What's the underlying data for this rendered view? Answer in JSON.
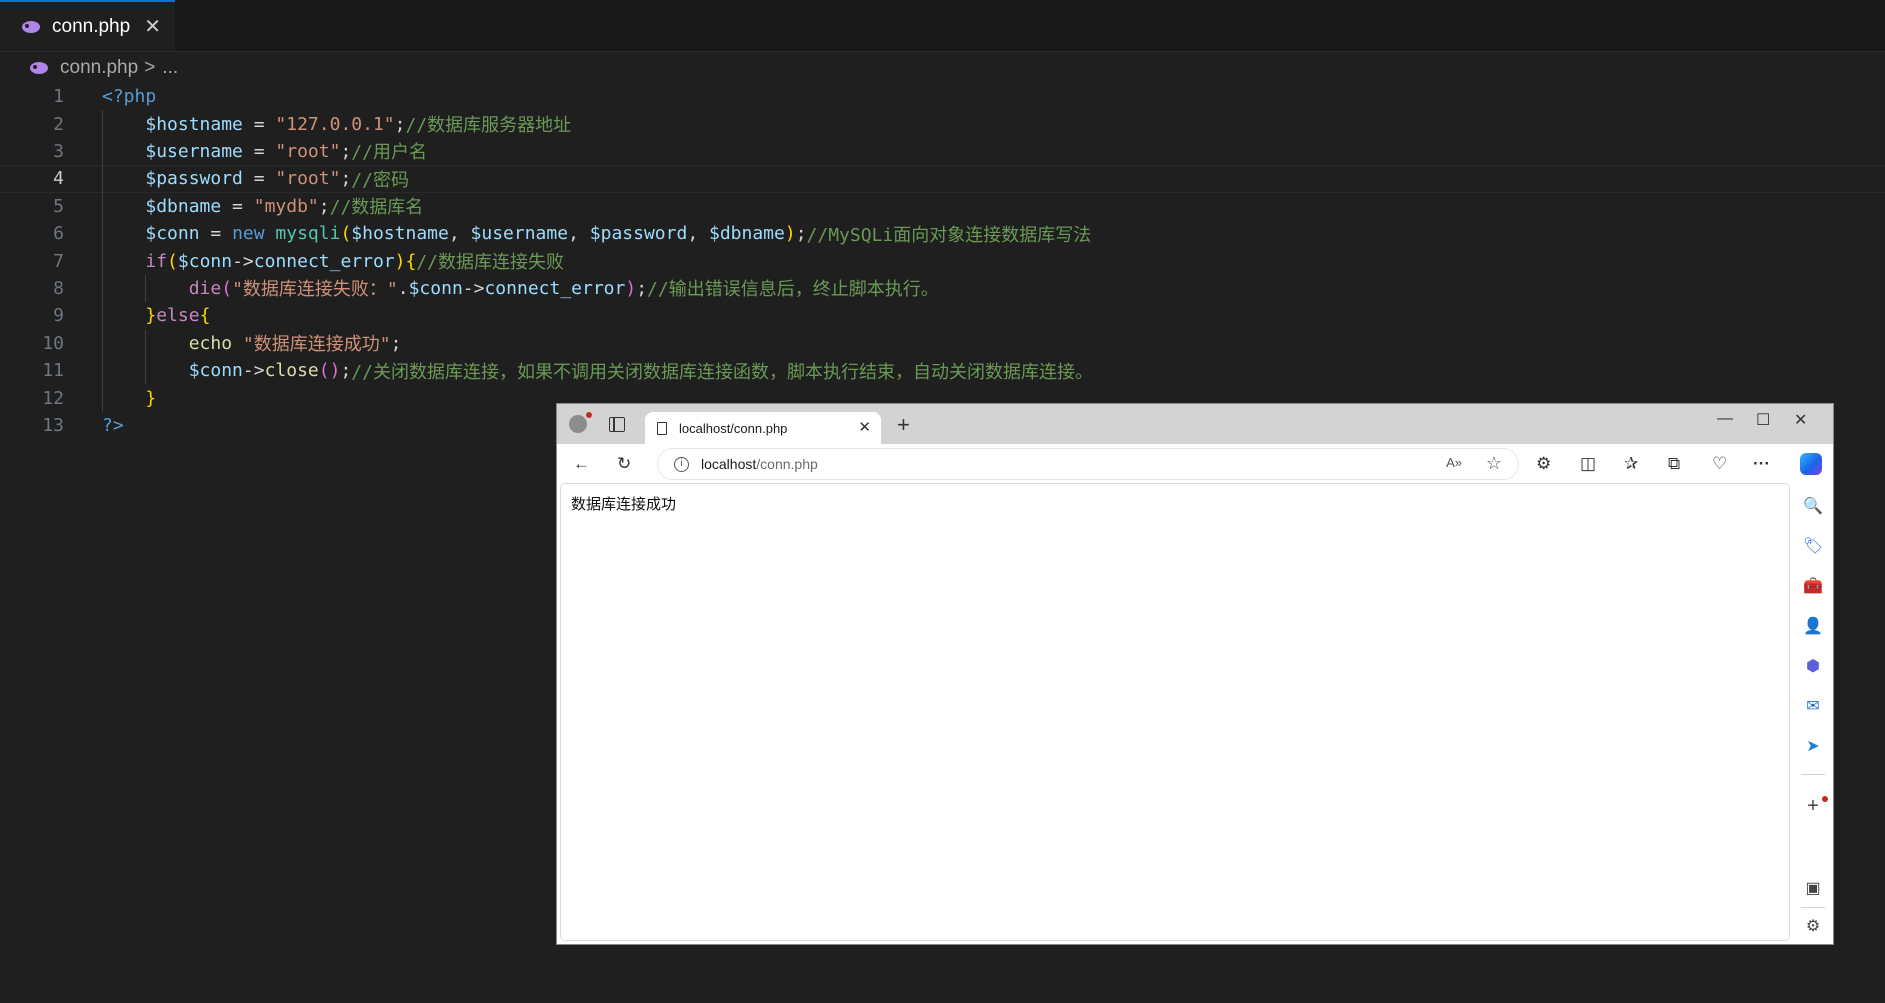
{
  "editor": {
    "tab_label": "conn.php",
    "tab_close": "✕",
    "breadcrumb_file": "conn.php",
    "breadcrumb_sep": ">",
    "breadcrumb_more": "...",
    "current_line": 4,
    "lines": [
      {
        "num": "1",
        "tokens": [
          [
            "t-tag",
            "<?php"
          ]
        ]
      },
      {
        "num": "2",
        "tokens": [
          [
            "t-op",
            "    "
          ],
          [
            "t-var",
            "$hostname"
          ],
          [
            "t-op",
            " = "
          ],
          [
            "t-str",
            "\"127.0.0.1\""
          ],
          [
            "t-op",
            ";"
          ],
          [
            "t-com",
            "//数据库服务器地址"
          ]
        ]
      },
      {
        "num": "3",
        "tokens": [
          [
            "t-op",
            "    "
          ],
          [
            "t-var",
            "$username"
          ],
          [
            "t-op",
            " = "
          ],
          [
            "t-str",
            "\"root\""
          ],
          [
            "t-op",
            ";"
          ],
          [
            "t-com",
            "//用户名"
          ]
        ]
      },
      {
        "num": "4",
        "tokens": [
          [
            "t-op",
            "    "
          ],
          [
            "t-var",
            "$password"
          ],
          [
            "t-op",
            " = "
          ],
          [
            "t-str",
            "\"root\""
          ],
          [
            "t-op",
            ";"
          ],
          [
            "t-com",
            "//密码"
          ]
        ]
      },
      {
        "num": "5",
        "tokens": [
          [
            "t-op",
            "    "
          ],
          [
            "t-var",
            "$dbname"
          ],
          [
            "t-op",
            " = "
          ],
          [
            "t-str",
            "\"mydb\""
          ],
          [
            "t-op",
            ";"
          ],
          [
            "t-com",
            "//数据库名"
          ]
        ]
      },
      {
        "num": "6",
        "tokens": [
          [
            "t-op",
            "    "
          ],
          [
            "t-var",
            "$conn"
          ],
          [
            "t-op",
            " = "
          ],
          [
            "t-kw",
            "new"
          ],
          [
            "t-op",
            " "
          ],
          [
            "t-cls",
            "mysqli"
          ],
          [
            "t-br1",
            "("
          ],
          [
            "t-var",
            "$hostname"
          ],
          [
            "t-op",
            ", "
          ],
          [
            "t-var",
            "$username"
          ],
          [
            "t-op",
            ", "
          ],
          [
            "t-var",
            "$password"
          ],
          [
            "t-op",
            ", "
          ],
          [
            "t-var",
            "$dbname"
          ],
          [
            "t-br1",
            ")"
          ],
          [
            "t-op",
            ";"
          ],
          [
            "t-com",
            "//MySQLi面向对象连接数据库写法"
          ]
        ]
      },
      {
        "num": "7",
        "tokens": [
          [
            "t-op",
            "    "
          ],
          [
            "t-ctl",
            "if"
          ],
          [
            "t-br1",
            "("
          ],
          [
            "t-var",
            "$conn"
          ],
          [
            "t-op",
            "->"
          ],
          [
            "t-var",
            "connect_error"
          ],
          [
            "t-br1",
            ")"
          ],
          [
            "t-br1",
            "{"
          ],
          [
            "t-com",
            "//数据库连接失败"
          ]
        ]
      },
      {
        "num": "8",
        "tokens": [
          [
            "t-op",
            "        "
          ],
          [
            "t-ctl",
            "die"
          ],
          [
            "t-br2",
            "("
          ],
          [
            "t-str",
            "\"数据库连接失败：\""
          ],
          [
            "t-op",
            "."
          ],
          [
            "t-var",
            "$conn"
          ],
          [
            "t-op",
            "->"
          ],
          [
            "t-var",
            "connect_error"
          ],
          [
            "t-br2",
            ")"
          ],
          [
            "t-op",
            ";"
          ],
          [
            "t-com",
            "//输出错误信息后，终止脚本执行。"
          ]
        ]
      },
      {
        "num": "9",
        "tokens": [
          [
            "t-op",
            "    "
          ],
          [
            "t-br1",
            "}"
          ],
          [
            "t-ctl",
            "else"
          ],
          [
            "t-br1",
            "{"
          ]
        ]
      },
      {
        "num": "10",
        "tokens": [
          [
            "t-op",
            "        "
          ],
          [
            "t-fn",
            "echo"
          ],
          [
            "t-op",
            " "
          ],
          [
            "t-str",
            "\"数据库连接成功\""
          ],
          [
            "t-op",
            ";"
          ]
        ]
      },
      {
        "num": "11",
        "tokens": [
          [
            "t-op",
            "        "
          ],
          [
            "t-var",
            "$conn"
          ],
          [
            "t-op",
            "->"
          ],
          [
            "t-fn",
            "close"
          ],
          [
            "t-br2",
            "()"
          ],
          [
            "t-op",
            ";"
          ],
          [
            "t-com",
            "//关闭数据库连接，如果不调用关闭数据库连接函数，脚本执行结束，自动关闭数据库连接。"
          ]
        ]
      },
      {
        "num": "12",
        "tokens": [
          [
            "t-op",
            "    "
          ],
          [
            "t-br1",
            "}"
          ]
        ]
      },
      {
        "num": "13",
        "tokens": [
          [
            "t-tag",
            "?>"
          ]
        ]
      }
    ]
  },
  "browser": {
    "tab_title": "localhost/conn.php",
    "tab_close": "✕",
    "new_tab": "+",
    "minimize": "—",
    "maximize": "☐",
    "close": "✕",
    "address_host": "localhost",
    "address_path": "/conn.php",
    "info_glyph": "i",
    "toolbar_icons": {
      "back": "←",
      "refresh": "↻",
      "read_aloud": "A»",
      "favorite": "☆",
      "extensions": "⚙",
      "split": "◫",
      "favorites": "✰",
      "collections": "⧉",
      "performance": "♡",
      "more": "···"
    },
    "sidebar_icons": [
      "🔍",
      "🏷",
      "🧰",
      "👤",
      "⬢",
      "✉",
      "➤",
      "+",
      "▣",
      "⚙"
    ],
    "page_text": "数据库连接成功"
  },
  "colors": {
    "editor_bg": "#1f1f1f",
    "tab_accent": "#0078d4",
    "keyword": "#569cd6",
    "variable": "#9cdcfe",
    "string": "#ce9178",
    "comment": "#6a9955"
  }
}
